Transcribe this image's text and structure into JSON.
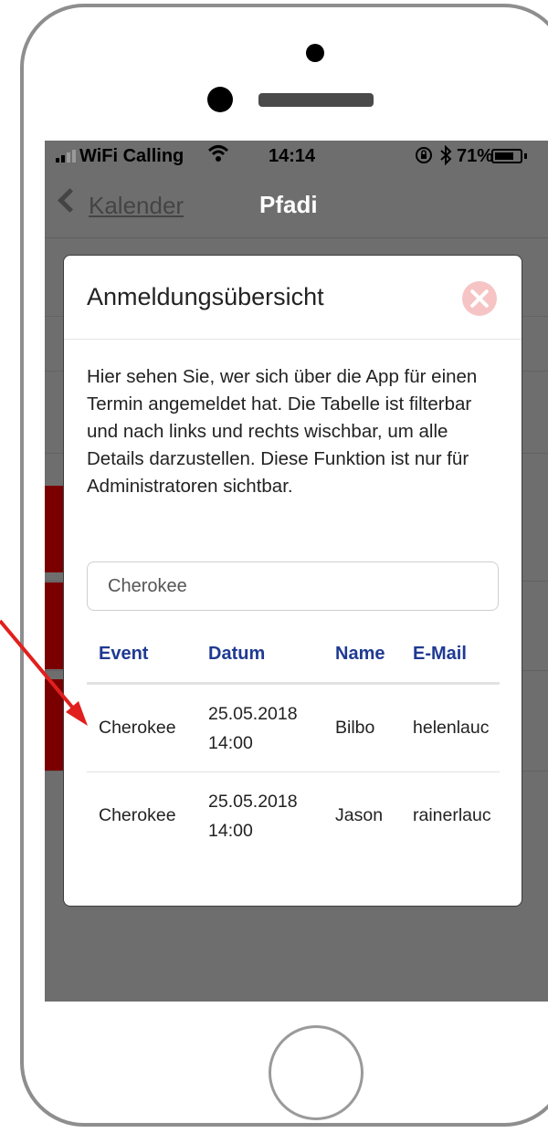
{
  "status_bar": {
    "carrier": "WiFi Calling",
    "time": "14:14",
    "battery_percent": "71%",
    "battery_level": 0.71,
    "wifi_icon": "wifi-icon",
    "bluetooth_icon": "bluetooth-icon",
    "orientation_lock_icon": "orientation-lock-icon"
  },
  "nav": {
    "back_label": "Kalender",
    "title": "Pfadi"
  },
  "modal": {
    "title": "Anmeldungsübersicht",
    "description": "Hier sehen Sie, wer sich über die App für einen Termin angemeldet hat. Die Tabelle ist filterbar und nach links und rechts wischbar, um alle Details darzustellen. Diese Funktion ist nur für Administratoren sichtbar.",
    "filter_value": "Cherokee",
    "table": {
      "headers": [
        "Event",
        "Datum",
        "Name",
        "E-Mail"
      ],
      "rows": [
        {
          "event": "Cherokee",
          "date": "25.05.2018",
          "time": "14:00",
          "name": "Bilbo",
          "email": "helenlauc"
        },
        {
          "event": "Cherokee",
          "date": "25.05.2018",
          "time": "14:00",
          "name": "Jason",
          "email": "rainerlauc"
        }
      ]
    }
  },
  "colors": {
    "header_blue": "#1f3a93",
    "close_pink": "#f6c4c4",
    "arrow_red": "#e0201e",
    "dim_background": "#6e6e6e",
    "list_red": "#7a0000"
  }
}
